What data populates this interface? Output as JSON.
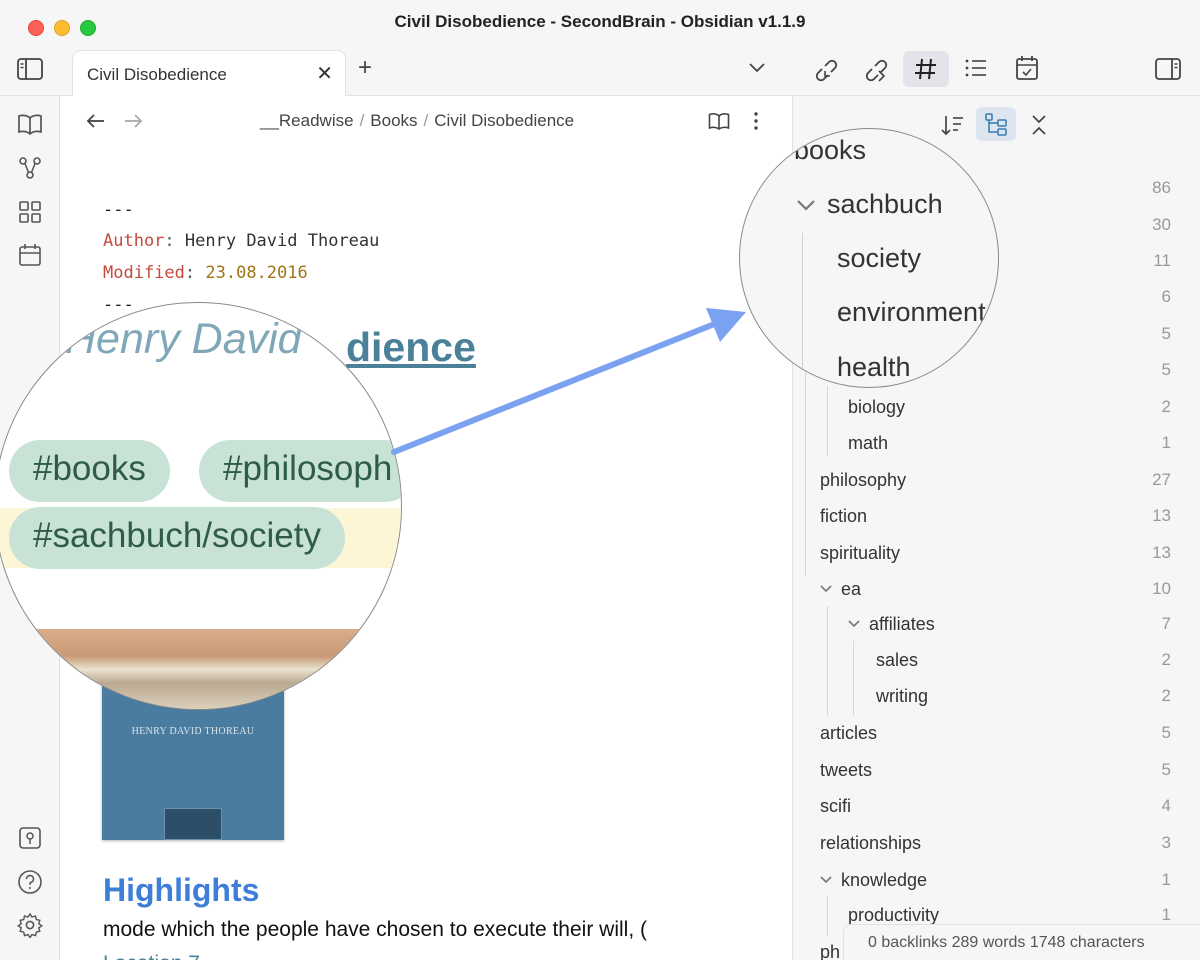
{
  "window": {
    "title": "Civil Disobedience - SecondBrain - Obsidian v1.1.9"
  },
  "tab": {
    "label": "Civil Disobedience",
    "close": "✕",
    "new": "+"
  },
  "breadcrumb": {
    "part1": "__Readwise",
    "part2": "Books",
    "part3": "Civil Disobedience",
    "sep": "/"
  },
  "frontmatter": {
    "delim": "---",
    "author_key": "Author",
    "author_val": "Henry David Thoreau",
    "modified_key": "Modified",
    "modified_val": "23.08.2016"
  },
  "note": {
    "title_visible": "dience",
    "book_cover_text": "HENRY DAVID THOREAU",
    "highlights_heading": "Highlights",
    "body_text": "mode which the people have chosen to execute their will, (",
    "body_link": "Location 7"
  },
  "zoom_left": {
    "title_fragment": "Henry David",
    "tags": [
      "#books",
      "#philosoph",
      "#sachbuch/society"
    ]
  },
  "zoom_right": {
    "root": "books",
    "parent": "sachbuch",
    "children": [
      "society",
      "environment",
      "health"
    ]
  },
  "tags_pane": {
    "items": [
      {
        "label": "books",
        "count": "86"
      },
      {
        "label": "sachbuch",
        "count": "30"
      },
      {
        "label": "society",
        "count": "11"
      },
      {
        "label": "environment",
        "count": "6"
      },
      {
        "label": "",
        "count": "5"
      },
      {
        "label": "health",
        "count": "5"
      },
      {
        "label": "biology",
        "count": "2"
      },
      {
        "label": "math",
        "count": "1"
      },
      {
        "label": "philosophy",
        "count": "27"
      },
      {
        "label": "fiction",
        "count": "13"
      },
      {
        "label": "spirituality",
        "count": "13"
      },
      {
        "label": "ea",
        "count": "10"
      },
      {
        "label": "affiliates",
        "count": "7"
      },
      {
        "label": "sales",
        "count": "2"
      },
      {
        "label": "writing",
        "count": "2"
      },
      {
        "label": "articles",
        "count": "5"
      },
      {
        "label": "tweets",
        "count": "5"
      },
      {
        "label": "scifi",
        "count": "4"
      },
      {
        "label": "relationships",
        "count": "3"
      },
      {
        "label": "knowledge",
        "count": "1"
      },
      {
        "label": "productivity",
        "count": "1"
      },
      {
        "label": "ph",
        "count": ""
      }
    ]
  },
  "status": {
    "text": "0 backlinks   289 words   1748 characters"
  },
  "colors": {
    "accent": "#3d7fd8",
    "tag_bg": "#c8e3d6",
    "arrow": "#7aa2f0"
  }
}
